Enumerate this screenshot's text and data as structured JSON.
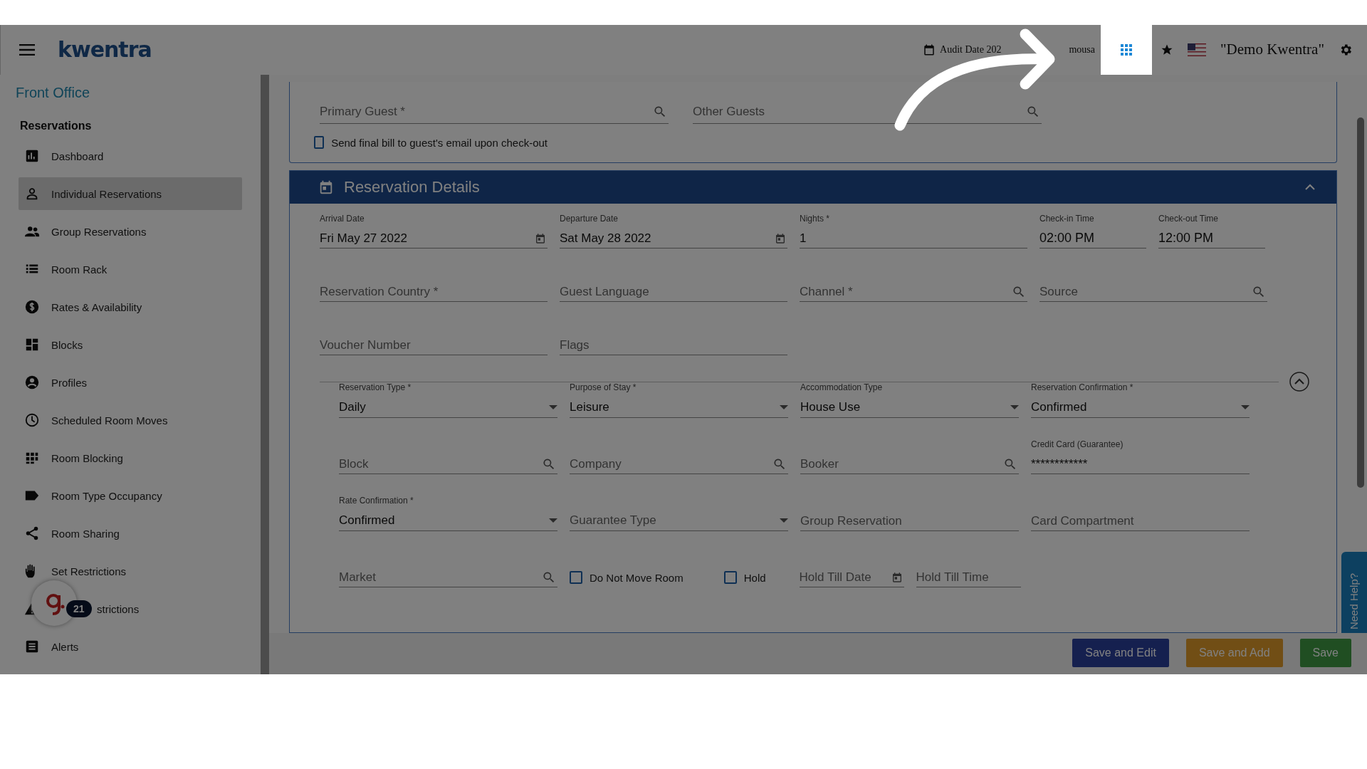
{
  "header": {
    "logo": "kwentra",
    "audit_date": "Audit Date 202",
    "user": "mousa",
    "account": "\"Demo Kwentra\""
  },
  "sidebar": {
    "module": "Front Office",
    "section": "Reservations",
    "items": [
      {
        "label": "Dashboard",
        "selected": false
      },
      {
        "label": "Individual Reservations",
        "selected": true
      },
      {
        "label": "Group Reservations",
        "selected": false
      },
      {
        "label": "Room Rack",
        "selected": false
      },
      {
        "label": "Rates & Availability",
        "selected": false
      },
      {
        "label": "Blocks",
        "selected": false
      },
      {
        "label": "Profiles",
        "selected": false
      },
      {
        "label": "Scheduled Room Moves",
        "selected": false
      },
      {
        "label": "Room Blocking",
        "selected": false
      },
      {
        "label": "Room Type Occupancy",
        "selected": false
      },
      {
        "label": "Room Sharing",
        "selected": false
      },
      {
        "label": "Set Restrictions",
        "selected": false
      },
      {
        "label": "strictions",
        "selected": false
      },
      {
        "label": "Alerts",
        "selected": false
      }
    ]
  },
  "helper_widget": {
    "badge": "21"
  },
  "guests": {
    "fields": [
      {
        "kind": "search",
        "placeholder": "Primary Guest *"
      },
      {
        "kind": "search",
        "placeholder": "Other Guests"
      }
    ],
    "email_bill": {
      "label": "Send final bill to guest's email upon check-out",
      "checked": false
    }
  },
  "details": {
    "title": "Reservation Details",
    "expanded": true,
    "rows": [
      [
        {
          "kind": "date",
          "label": "Arrival Date",
          "value": "Fri May 27 2022"
        },
        {
          "kind": "date",
          "label": "Departure Date",
          "value": "Sat May 28 2022"
        },
        {
          "kind": "text",
          "label": "Nights *",
          "value": "1"
        },
        {
          "kind": "time",
          "label": "Check-in Time",
          "value": "02:00 PM"
        },
        {
          "kind": "time",
          "label": "Check-out Time",
          "value": "12:00 PM"
        }
      ],
      [
        {
          "kind": "text",
          "placeholder": "Reservation Country *"
        },
        {
          "kind": "text",
          "placeholder": "Guest Language"
        },
        {
          "kind": "search",
          "placeholder": "Channel *"
        },
        {
          "kind": "search",
          "placeholder": "Source"
        }
      ],
      [
        {
          "kind": "text",
          "placeholder": "Voucher Number"
        },
        {
          "kind": "text",
          "placeholder": "Flags"
        }
      ]
    ],
    "more_expanded": true,
    "more_rows": [
      [
        {
          "kind": "select",
          "label": "Reservation Type *",
          "value": "Daily"
        },
        {
          "kind": "select",
          "label": "Purpose of Stay *",
          "value": "Leisure"
        },
        {
          "kind": "select",
          "label": "Accommodation Type",
          "value": "House Use"
        },
        {
          "kind": "select",
          "label": "Reservation Confirmation *",
          "value": "Confirmed"
        }
      ],
      [
        {
          "kind": "search",
          "placeholder": "Block"
        },
        {
          "kind": "search",
          "placeholder": "Company"
        },
        {
          "kind": "search",
          "placeholder": "Booker"
        },
        {
          "kind": "text",
          "label": "Credit Card (Guarantee)",
          "value": "************"
        }
      ],
      [
        {
          "kind": "select",
          "label": "Rate Confirmation *",
          "value": "Confirmed"
        },
        {
          "kind": "select",
          "placeholder": "Guarantee Type"
        },
        {
          "kind": "text",
          "placeholder": "Group Reservation"
        },
        {
          "kind": "text",
          "placeholder": "Card Compartment"
        }
      ],
      [
        {
          "kind": "search",
          "placeholder": "Market"
        },
        {
          "kind": "checkbox",
          "label": "Do Not Move Room",
          "checked": false
        },
        {
          "kind": "checkbox",
          "label": "Hold",
          "checked": false
        },
        {
          "kind": "date",
          "placeholder": "Hold Till Date"
        },
        {
          "kind": "text",
          "placeholder": "Hold Till Time"
        }
      ]
    ]
  },
  "actions": [
    {
      "kind": "edit",
      "label": "Save and Edit"
    },
    {
      "kind": "add",
      "label": "Save and Add"
    },
    {
      "kind": "save",
      "label": "Save"
    }
  ],
  "need_help": "Need Help?"
}
